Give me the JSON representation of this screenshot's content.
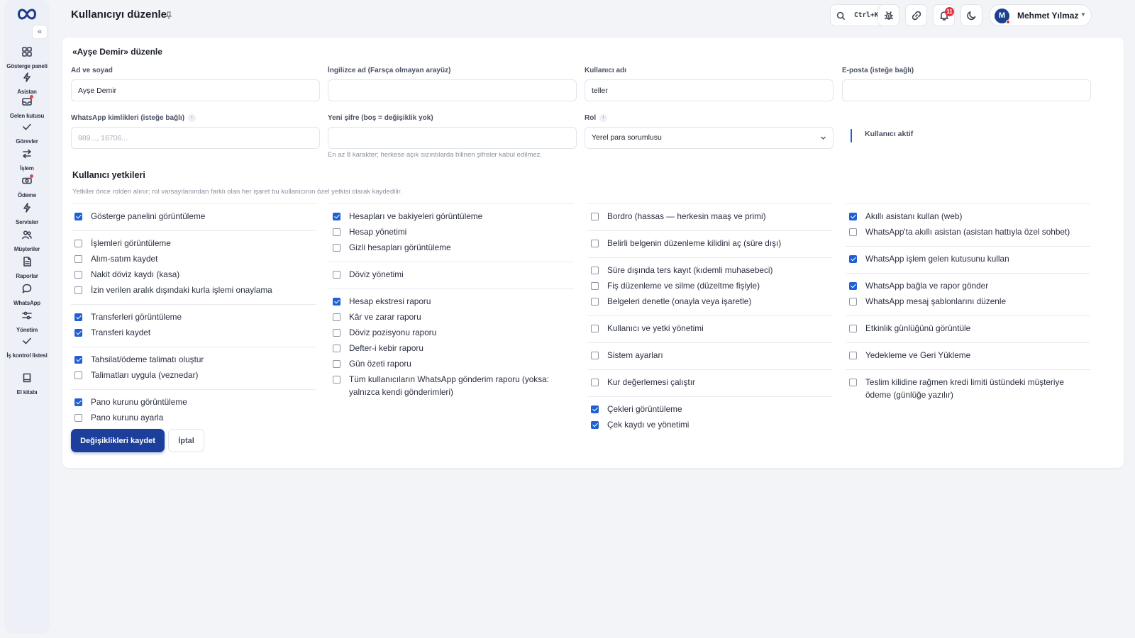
{
  "sidebar": {
    "items": [
      {
        "label": "Gösterge paneli",
        "icon": "grid-icon"
      },
      {
        "label": "Asistan",
        "icon": "bolt-icon"
      },
      {
        "label": "Gelen kutusu",
        "icon": "inbox-icon"
      },
      {
        "label": "Görevler",
        "icon": "check-icon"
      },
      {
        "label": "İşlem",
        "icon": "transfer-icon"
      },
      {
        "label": "Ödeme",
        "icon": "cash-icon"
      },
      {
        "label": "Servisler",
        "icon": "bolt-icon"
      },
      {
        "label": "Müşteriler",
        "icon": "users-icon"
      },
      {
        "label": "Raporlar",
        "icon": "file-icon"
      },
      {
        "label": "WhatsApp",
        "icon": "chat-icon"
      },
      {
        "label": "Yönetim",
        "icon": "sliders-icon"
      },
      {
        "label": "İş kontrol listesi",
        "icon": "check-icon"
      },
      {
        "label": "El kitabı",
        "icon": "book-icon"
      }
    ]
  },
  "header": {
    "title": "Kullanıcıyı düzenle",
    "search_shortcut": "Ctrl+K",
    "notification_count": "11",
    "user": {
      "initial": "M",
      "name": "Mehmet Yılmaz"
    }
  },
  "form": {
    "card_title": "«Ayşe Demir» düzenle",
    "full_name": {
      "label": "Ad ve soyad",
      "value": "Ayşe Demir"
    },
    "english_name": {
      "label": "İngilizce ad (Farsça olmayan arayüz)",
      "value": ""
    },
    "username": {
      "label": "Kullanıcı adı",
      "value": "teller"
    },
    "email": {
      "label": "E-posta (isteğe bağlı)",
      "value": ""
    },
    "whatsapp": {
      "label": "WhatsApp kimlikleri (isteğe bağlı)",
      "placeholder": "989..., 16706..."
    },
    "password": {
      "label": "Yeni şifre (boş = değişiklik yok)",
      "value": "",
      "hint": "En az 8 karakter; herkese açık sızıntılarda bilinen şifreler kabul edilmez."
    },
    "role": {
      "label": "Rol",
      "value": "Yerel para sorumlusu"
    },
    "active": {
      "label": "Kullanıcı aktif",
      "checked": true
    }
  },
  "permissions": {
    "title": "Kullanıcı yetkileri",
    "description": "Yetkiler önce rolden alınır; rol varsayılanından farklı olan her işaret bu kullanıcının özel yetkisi olarak kaydedilir.",
    "columns": [
      [
        [
          {
            "label": "Gösterge panelini görüntüleme",
            "checked": true
          }
        ],
        [
          {
            "label": "İşlemleri görüntüleme",
            "checked": false
          },
          {
            "label": "Alım-satım kaydet",
            "checked": false
          },
          {
            "label": "Nakit döviz kaydı (kasa)",
            "checked": false
          },
          {
            "label": "İzin verilen aralık dışındaki kurla işlemi onaylama",
            "checked": false
          }
        ],
        [
          {
            "label": "Transferleri görüntüleme",
            "checked": true
          },
          {
            "label": "Transferi kaydet",
            "checked": true
          }
        ],
        [
          {
            "label": "Tahsilat/ödeme talimatı oluştur",
            "checked": true
          },
          {
            "label": "Talimatları uygula (veznedar)",
            "checked": false
          }
        ],
        [
          {
            "label": "Pano kurunu görüntüleme",
            "checked": true
          },
          {
            "label": "Pano kurunu ayarla",
            "checked": false
          }
        ]
      ],
      [
        [
          {
            "label": "Hesapları ve bakiyeleri görüntüleme",
            "checked": true
          },
          {
            "label": "Hesap yönetimi",
            "checked": false
          },
          {
            "label": "Gizli hesapları görüntüleme",
            "checked": false
          }
        ],
        [
          {
            "label": "Döviz yönetimi",
            "checked": false
          }
        ],
        [
          {
            "label": "Hesap ekstresi raporu",
            "checked": true
          },
          {
            "label": "Kâr ve zarar raporu",
            "checked": false
          },
          {
            "label": "Döviz pozisyonu raporu",
            "checked": false
          },
          {
            "label": "Defter-i kebir raporu",
            "checked": false
          },
          {
            "label": "Gün özeti raporu",
            "checked": false
          },
          {
            "label": "Tüm kullanıcıların WhatsApp gönderim raporu (yoksa: yalnızca kendi gönderimleri)",
            "checked": false
          }
        ]
      ],
      [
        [
          {
            "label": "Bordro (hassas — herkesin maaş ve primi)",
            "checked": false
          }
        ],
        [
          {
            "label": "Belirli belgenin düzenleme kilidini aç (süre dışı)",
            "checked": false
          }
        ],
        [
          {
            "label": "Süre dışında ters kayıt (kıdemli muhasebeci)",
            "checked": false
          },
          {
            "label": "Fiş düzenleme ve silme (düzeltme fişiyle)",
            "checked": false
          },
          {
            "label": "Belgeleri denetle (onayla veya işaretle)",
            "checked": false
          }
        ],
        [
          {
            "label": "Kullanıcı ve yetki yönetimi",
            "checked": false
          }
        ],
        [
          {
            "label": "Sistem ayarları",
            "checked": false
          }
        ],
        [
          {
            "label": "Kur değerlemesi çalıştır",
            "checked": false
          }
        ],
        [
          {
            "label": "Çekleri görüntüleme",
            "checked": true
          },
          {
            "label": "Çek kaydı ve yönetimi",
            "checked": true
          }
        ]
      ],
      [
        [
          {
            "label": "Akıllı asistanı kullan (web)",
            "checked": true
          },
          {
            "label": "WhatsApp'ta akıllı asistan (asistan hattıyla özel sohbet)",
            "checked": false
          }
        ],
        [
          {
            "label": "WhatsApp işlem gelen kutusunu kullan",
            "checked": true
          }
        ],
        [
          {
            "label": "WhatsApp bağla ve rapor gönder",
            "checked": true
          },
          {
            "label": "WhatsApp mesaj şablonlarını düzenle",
            "checked": false
          }
        ],
        [
          {
            "label": "Etkinlik günlüğünü görüntüle",
            "checked": false
          }
        ],
        [
          {
            "label": "Yedekleme ve Geri Yükleme",
            "checked": false
          }
        ],
        [
          {
            "label": "Teslim kilidine rağmen kredi limiti üstündeki müşteriye ödeme (günlüğe yazılır)",
            "checked": false
          }
        ]
      ]
    ]
  },
  "actions": {
    "save_label": "Değişiklikleri kaydet",
    "cancel_label": "İptal"
  },
  "colors": {
    "primary": "#1b3f9a",
    "checkbox": "#2060d6",
    "badge": "#e3303c"
  }
}
